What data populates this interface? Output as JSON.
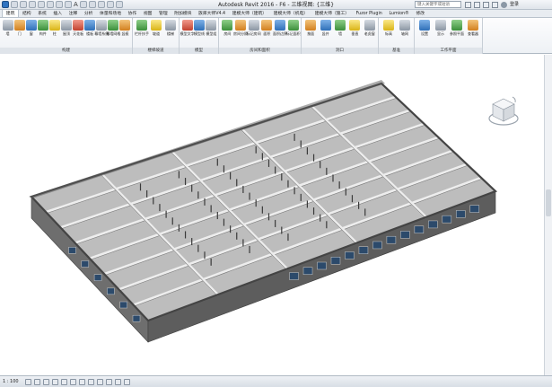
{
  "app": {
    "window_title": "Autodesk Revit 2016 -",
    "view_name": "F6 - 三维视图: {三维}",
    "search_placeholder": "键入关键字或短语",
    "user_label": "登录"
  },
  "tabs": [
    "建筑",
    "结构",
    "系统",
    "插入",
    "注释",
    "分析",
    "体量和场地",
    "协作",
    "视图",
    "管理",
    "附加模块",
    "族库大师V4.4",
    "建模大师（建筑）",
    "建模大师（机电）",
    "建模大师（施工）",
    "Fuzor Plugin",
    "Lumion®",
    "修改"
  ],
  "active_tab": "建筑",
  "ribbon": {
    "panels": [
      {
        "label": "构建",
        "tools": [
          "墙",
          "门",
          "窗",
          "构件",
          "柱",
          "屋顶",
          "天花板",
          "楼板",
          "幕墙系统",
          "幕墙网格",
          "竖梃"
        ]
      },
      {
        "label": "楼梯坡道",
        "tools": [
          "栏杆扶手",
          "坡道",
          "楼梯"
        ]
      },
      {
        "label": "模型",
        "tools": [
          "模型文字",
          "模型线",
          "模型组"
        ]
      },
      {
        "label": "房间和面积",
        "tools": [
          "房间",
          "房间分隔",
          "标记房间",
          "面积",
          "面积边界",
          "标记面积"
        ]
      },
      {
        "label": "洞口",
        "tools": [
          "按面",
          "竖井",
          "墙",
          "垂直",
          "老虎窗"
        ]
      },
      {
        "label": "基准",
        "tools": [
          "标高",
          "轴网"
        ]
      },
      {
        "label": "工作平面",
        "tools": [
          "设置",
          "显示",
          "参照平面",
          "查看器"
        ]
      }
    ]
  },
  "status": {
    "scale": "1 : 100"
  },
  "colors": {
    "ribbon_bg": "#eef1f5",
    "roof_top": "#5a5a5a",
    "wall_front": "#6e6e6e",
    "floor": "#bdbdbd",
    "window_blue": "#2c4a6b"
  }
}
